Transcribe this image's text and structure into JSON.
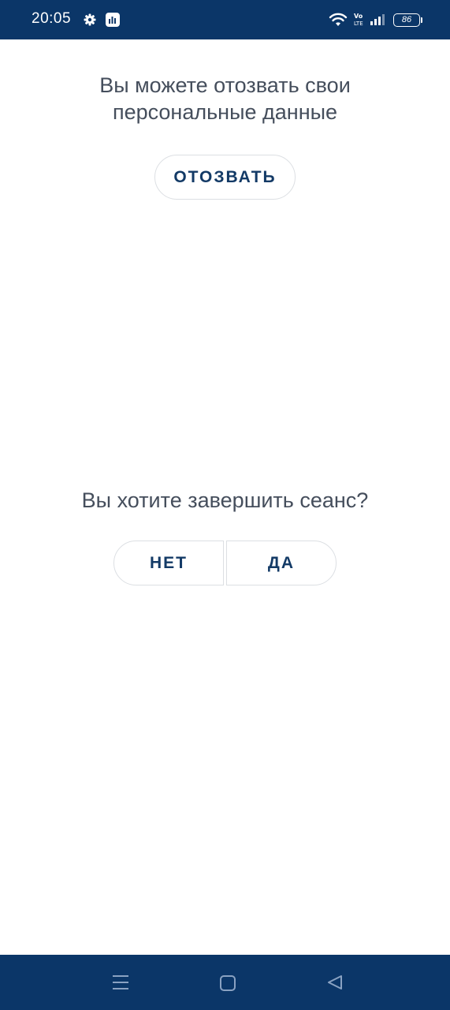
{
  "status_bar": {
    "time": "20:05",
    "battery_level": "86",
    "icons": [
      "gear-icon",
      "app-notification-icon",
      "wifi-icon",
      "volte-icon",
      "signal-icon",
      "battery-icon"
    ]
  },
  "revoke_section": {
    "text": "Вы можете отозвать свои персональные данные",
    "button_label": "ОТОЗВАТЬ"
  },
  "logout_section": {
    "question": "Вы хотите завершить сеанс?",
    "no_label": "НЕТ",
    "yes_label": "ДА"
  },
  "nav_bar": {
    "icons": [
      "menu-icon",
      "home-icon",
      "back-icon"
    ]
  },
  "colors": {
    "bar_background": "#0b3668",
    "button_text": "#133a66",
    "body_text": "#454e5c",
    "button_border": "#dcdfe3"
  }
}
